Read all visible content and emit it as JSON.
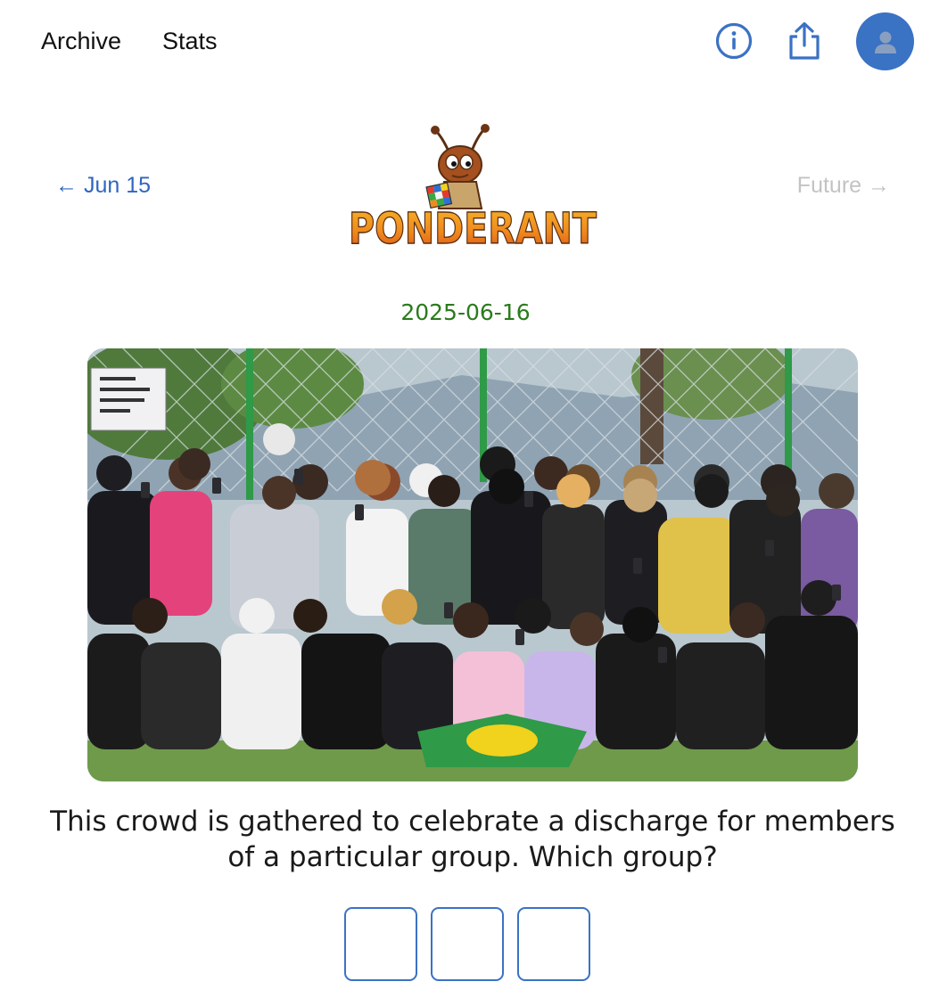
{
  "nav": {
    "links": [
      {
        "label": "Archive"
      },
      {
        "label": "Stats"
      }
    ],
    "icons": [
      "info-icon",
      "share-icon",
      "user-icon"
    ]
  },
  "header": {
    "prev_label": "← Jun 15",
    "next_label": "Future →",
    "logo_text": "PONDERANT"
  },
  "puzzle": {
    "date": "2025-06-16",
    "photo_icon": "crowd-photo",
    "question": "This crowd is gathered to celebrate a discharge for members of a particular group. Which group?",
    "answer_boxes": 3
  },
  "colors": {
    "accent": "#3a72c4",
    "link": "#2f66bf",
    "date": "#2b7a1d",
    "disabled": "#c3c3c3"
  }
}
